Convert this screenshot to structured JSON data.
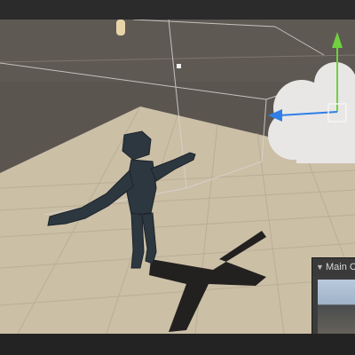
{
  "window": {
    "name": "scene-view"
  },
  "camera_preview": {
    "title": "Main C",
    "toggle_icon": "triangle-down-icon"
  },
  "gizmo": {
    "y_axis_color": "#6fd13f",
    "x_axis_color": "#2f7fe6",
    "camera_icon": "cloud-camera-icon"
  },
  "scene": {
    "ground_color": "#cbbfa6",
    "sky_color": "#5b5550",
    "character_color": "#2d3740",
    "grid": true
  }
}
